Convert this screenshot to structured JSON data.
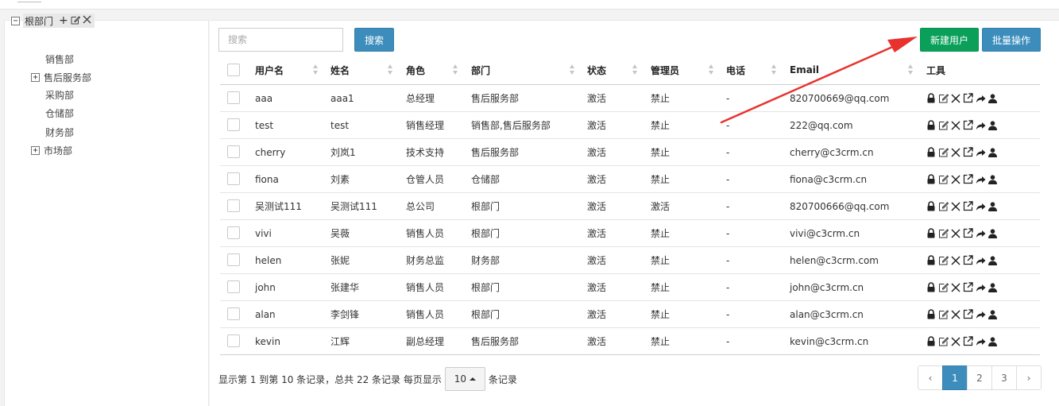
{
  "tree": {
    "root_label": "根部门",
    "children": [
      {
        "label": "销售部",
        "expandable": false
      },
      {
        "label": "售后服务部",
        "expandable": true
      },
      {
        "label": "采购部",
        "expandable": false
      },
      {
        "label": "仓储部",
        "expandable": false
      },
      {
        "label": "财务部",
        "expandable": false
      },
      {
        "label": "市场部",
        "expandable": true
      }
    ]
  },
  "toolbar": {
    "search_placeholder": "搜索",
    "search_button": "搜索",
    "new_user_button": "新建用户",
    "batch_button": "批量操作"
  },
  "table": {
    "columns": [
      "用户名",
      "姓名",
      "角色",
      "部门",
      "状态",
      "管理员",
      "电话",
      "Email",
      "工具"
    ],
    "rows": [
      {
        "username": "aaa",
        "name": "aaa1",
        "role": "总经理",
        "dept": "售后服务部",
        "status": "激活",
        "admin": "禁止",
        "phone": "-",
        "email": "820700669@qq.com"
      },
      {
        "username": "test",
        "name": "test",
        "role": "销售经理",
        "dept": "销售部,售后服务部",
        "status": "激活",
        "admin": "禁止",
        "phone": "-",
        "email": "222@qq.com"
      },
      {
        "username": "cherry",
        "name": "刘岚1",
        "role": "技术支持",
        "dept": "售后服务部",
        "status": "激活",
        "admin": "禁止",
        "phone": "-",
        "email": "cherry@c3crm.cn"
      },
      {
        "username": "fiona",
        "name": "刘素",
        "role": "仓管人员",
        "dept": "仓储部",
        "status": "激活",
        "admin": "禁止",
        "phone": "-",
        "email": "fiona@c3crm.cn"
      },
      {
        "username": "吴测试111",
        "name": "吴测试111",
        "role": "总公司",
        "dept": "根部门",
        "status": "激活",
        "admin": "激活",
        "phone": "-",
        "email": "820700666@qq.com"
      },
      {
        "username": "vivi",
        "name": "吴薇",
        "role": "销售人员",
        "dept": "根部门",
        "status": "激活",
        "admin": "禁止",
        "phone": "-",
        "email": "vivi@c3crm.cn"
      },
      {
        "username": "helen",
        "name": "张妮",
        "role": "财务总监",
        "dept": "财务部",
        "status": "激活",
        "admin": "禁止",
        "phone": "-",
        "email": "helen@c3crm.com"
      },
      {
        "username": "john",
        "name": "张建华",
        "role": "销售人员",
        "dept": "根部门",
        "status": "激活",
        "admin": "禁止",
        "phone": "-",
        "email": "john@c3crm.cn"
      },
      {
        "username": "alan",
        "name": "李剑锋",
        "role": "销售人员",
        "dept": "根部门",
        "status": "激活",
        "admin": "禁止",
        "phone": "-",
        "email": "alan@c3crm.cn"
      },
      {
        "username": "kevin",
        "name": "江辉",
        "role": "副总经理",
        "dept": "售后服务部",
        "status": "激活",
        "admin": "禁止",
        "phone": "-",
        "email": "kevin@c3crm.cn"
      }
    ],
    "row_tools": [
      "lock-icon",
      "edit-icon",
      "delete-icon",
      "open-external-icon",
      "share-icon",
      "user-icon"
    ]
  },
  "footer": {
    "info_prefix": "显示第 1 到第 10 条记录，总共 22 条记录 每页显示",
    "page_size": "10",
    "info_suffix": "条记录",
    "pages": [
      "‹",
      "1",
      "2",
      "3",
      "›"
    ],
    "active_page": "1"
  },
  "colors": {
    "primary": "#3c8dbc",
    "success": "#0aa059",
    "annotation_arrow": "#e8322e"
  }
}
